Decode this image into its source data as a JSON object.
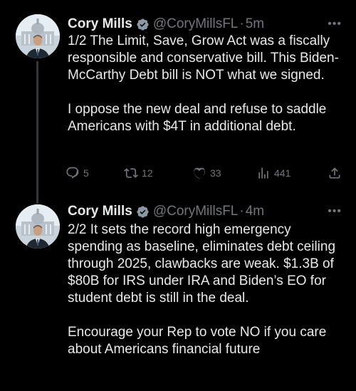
{
  "tweets": [
    {
      "author_name": "Cory Mills",
      "handle": "@CoryMillsFL",
      "separator": "·",
      "time": "5m",
      "text": "1/2 The Limit, Save, Grow Act was a fiscally responsible and conservative bill. This Biden-McCarthy Debt bill is NOT what we signed.\n\nI oppose the new deal and refuse to saddle Americans with $4T in additional debt.",
      "stats": {
        "replies": "5",
        "retweets": "12",
        "likes": "33",
        "views": "441"
      }
    },
    {
      "author_name": "Cory Mills",
      "handle": "@CoryMillsFL",
      "separator": "·",
      "time": "4m",
      "text": "2/2 It sets the record high emergency spending as baseline, eliminates debt ceiling through 2025, clawbacks are weak. $1.3B of $80B for IRS under IRA and Biden’s EO for student debt is still in the deal.\n\nEncourage your Rep to vote NO if you care about Americans financial future"
    }
  ],
  "colors": {
    "background": "#000000",
    "text": "#e7e9ea",
    "muted": "#71767b",
    "verified_badge": "#8b98a5"
  },
  "icons": [
    "verified-badge-icon",
    "more-options-icon",
    "reply-icon",
    "retweet-icon",
    "like-icon",
    "views-icon",
    "share-icon"
  ]
}
